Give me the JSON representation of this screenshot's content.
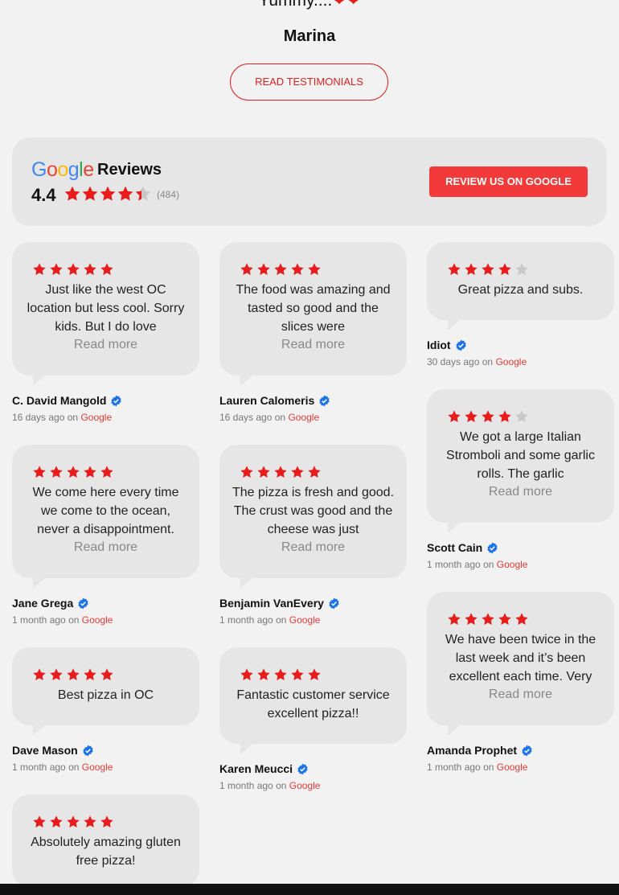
{
  "hero": {
    "quote_text": "Yummy....",
    "hearts": "❤❤",
    "author": "Marina",
    "button_label": "READ TESTIMONIALS"
  },
  "summary": {
    "logo_letters": [
      "G",
      "o",
      "o",
      "g",
      "l",
      "e"
    ],
    "reviews_word": "Reviews",
    "rating": "4.4",
    "rating_value": 4.4,
    "review_count": "(484)",
    "button_label": "REVIEW US ON GOOGLE"
  },
  "colors": {
    "accent": "#e02020",
    "star": "#e81c1c",
    "star_empty": "#c8c8c8",
    "verified": "#1a73e8",
    "google_blue": "#4285F4",
    "google_red": "#EA4335",
    "google_yellow": "#FBBC05",
    "google_green": "#34A853"
  },
  "icons": {
    "star": "star-icon",
    "verified": "verified-check-icon"
  },
  "read_more_label": "Read more",
  "source_prefix": "on",
  "reviews": [
    {
      "text": "Just like the west OC location but less cool. Sorry kids. But I do love",
      "rating": 5,
      "name": "C. David Mangold",
      "age": "16 days ago",
      "source": "Google",
      "read_more": true
    },
    {
      "text": "We come here every time we come to the ocean, never a disappointment.",
      "rating": 5,
      "name": "Jane Grega",
      "age": "1 month ago",
      "source": "Google",
      "read_more": true
    },
    {
      "text": "Best pizza in OC",
      "rating": 5,
      "name": "Dave Mason",
      "age": "1 month ago",
      "source": "Google",
      "read_more": false
    },
    {
      "text": "Absolutely amazing gluten free pizza!",
      "rating": 5,
      "name": "",
      "age": "",
      "source": "",
      "read_more": false
    },
    {
      "text": "The food was amazing and tasted so good and the slices were",
      "rating": 5,
      "name": "Lauren Calomeris",
      "age": "16 days ago",
      "source": "Google",
      "read_more": true
    },
    {
      "text": "The pizza is fresh and good. The crust was good and the cheese was just",
      "rating": 5,
      "name": "Benjamin VanEvery",
      "age": "1 month ago",
      "source": "Google",
      "read_more": true
    },
    {
      "text": "Fantastic customer service excellent pizza!!",
      "rating": 5,
      "name": "Karen Meucci",
      "age": "1 month ago",
      "source": "Google",
      "read_more": false
    },
    {
      "text": "Great pizza and subs.",
      "rating": 4,
      "name": "Idiot",
      "age": "30 days ago",
      "source": "Google",
      "read_more": false
    },
    {
      "text": "We got a large Italian Stromboli and some garlic rolls. The garlic",
      "rating": 4,
      "name": "Scott Cain",
      "age": "1 month ago",
      "source": "Google",
      "read_more": true
    },
    {
      "text": "We have been twice in the last week and it’s been excellent each time. Very",
      "rating": 5,
      "name": "Amanda Prophet",
      "age": "1 month ago",
      "source": "Google",
      "read_more": true
    }
  ]
}
